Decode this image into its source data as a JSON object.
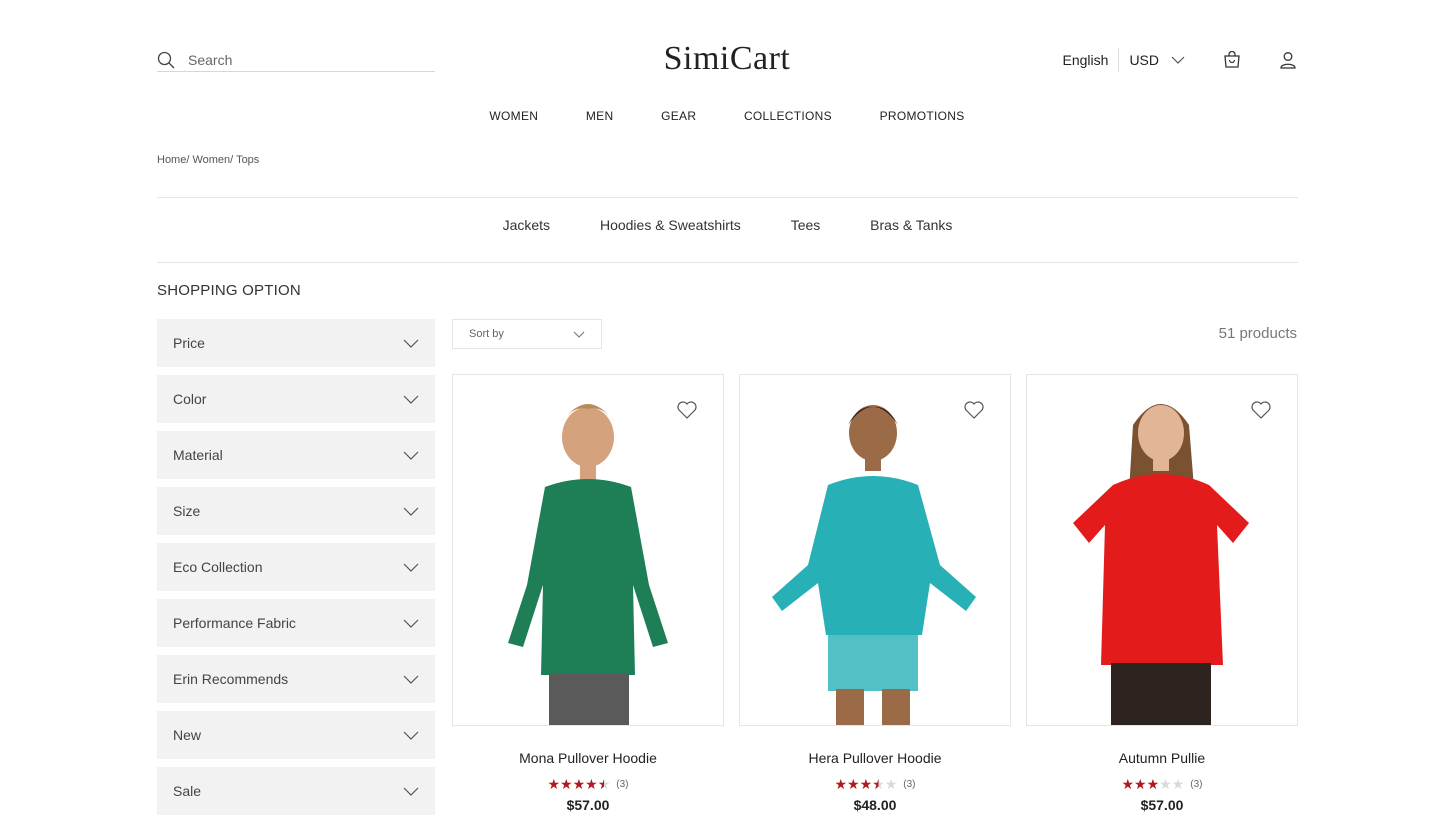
{
  "header": {
    "search_placeholder": "Search",
    "logo": "SimiCart",
    "language": "English",
    "currency": "USD"
  },
  "nav": [
    "WOMEN",
    "MEN",
    "GEAR",
    "COLLECTIONS",
    "PROMOTIONS"
  ],
  "breadcrumb": "Home/ Women/ Tops",
  "subcategories": [
    "Jackets",
    "Hoodies & Sweatshirts",
    "Tees",
    "Bras & Tanks"
  ],
  "sidebar": {
    "title": "SHOPPING OPTION",
    "filters": [
      "Price",
      "Color",
      "Material",
      "Size",
      "Eco Collection",
      "Performance Fabric",
      "Erin Recommends",
      "New",
      "Sale"
    ]
  },
  "toolbar": {
    "sort_label": "Sort by",
    "count": "51 products"
  },
  "products": [
    {
      "name": "Mona Pullover Hoodie",
      "rating": 4.5,
      "reviews": "(3)",
      "price": "$57.00",
      "color": "#1e7f57"
    },
    {
      "name": "Hera Pullover Hoodie",
      "rating": 3.5,
      "reviews": "(3)",
      "price": "$48.00",
      "color": "#27b0b5"
    },
    {
      "name": "Autumn Pullie",
      "rating": 3,
      "reviews": "(3)",
      "price": "$57.00",
      "color": "#e31b1b"
    }
  ],
  "colors": {
    "star": "#b0191e",
    "star_empty": "#d9d9d9"
  }
}
